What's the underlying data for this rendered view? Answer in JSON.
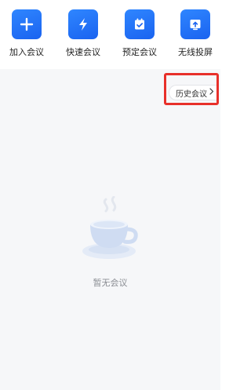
{
  "actions": [
    {
      "label": "加入会议",
      "icon": "plus-icon"
    },
    {
      "label": "快速会议",
      "icon": "lightning-icon"
    },
    {
      "label": "预定会议",
      "icon": "calendar-check-icon"
    },
    {
      "label": "无线投屏",
      "icon": "screen-cast-icon"
    }
  ],
  "history": {
    "label": "历史会议",
    "icon": "chevron-right-icon"
  },
  "empty_state": {
    "text": "暂无会议",
    "icon": "coffee-cup-icon"
  },
  "colors": {
    "accent": "#1a6ef5",
    "highlight": "#e8302a",
    "background": "#f6f7f9"
  }
}
